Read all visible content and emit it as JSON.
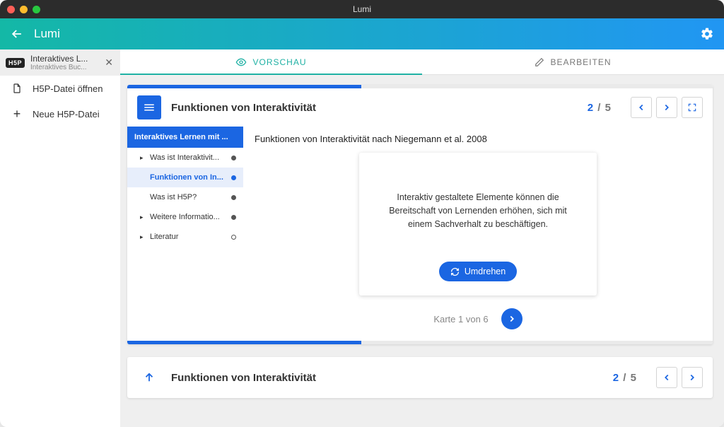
{
  "window": {
    "title": "Lumi"
  },
  "appbar": {
    "title": "Lumi"
  },
  "sidebar": {
    "tab": {
      "title": "Interaktives L...",
      "subtitle": "Interaktives Buc..."
    },
    "open_label": "H5P-Datei öffnen",
    "new_label": "Neue H5P-Datei"
  },
  "tabs": {
    "preview": "VORSCHAU",
    "edit": "BEARBEITEN"
  },
  "book": {
    "title": "Funktionen von Interaktivität",
    "page": "2",
    "total": "5",
    "toc_title": "Interaktives Lernen mit ...",
    "toc": [
      {
        "label": "Was ist Interaktivit...",
        "expandable": true,
        "filled": true
      },
      {
        "label": "Funktionen von In...",
        "expandable": false,
        "filled": true,
        "active": true
      },
      {
        "label": "Was ist H5P?",
        "expandable": false,
        "filled": true
      },
      {
        "label": "Weitere Informatio...",
        "expandable": true,
        "filled": true
      },
      {
        "label": "Literatur",
        "expandable": true,
        "filled": false
      }
    ],
    "content_heading": "Funktionen von Interaktivität nach Niegemann et al. 2008",
    "flashcard": {
      "text": "Interaktiv gestaltete Elemente können die Bereitschaft von Lernenden erhöhen, sich mit einem Sachverhalt zu beschäftigen.",
      "flip_label": "Umdrehen",
      "counter": "Karte 1 von 6"
    },
    "footer_title": "Funktionen von Interaktivität",
    "footer_page": "2",
    "footer_total": "5"
  }
}
